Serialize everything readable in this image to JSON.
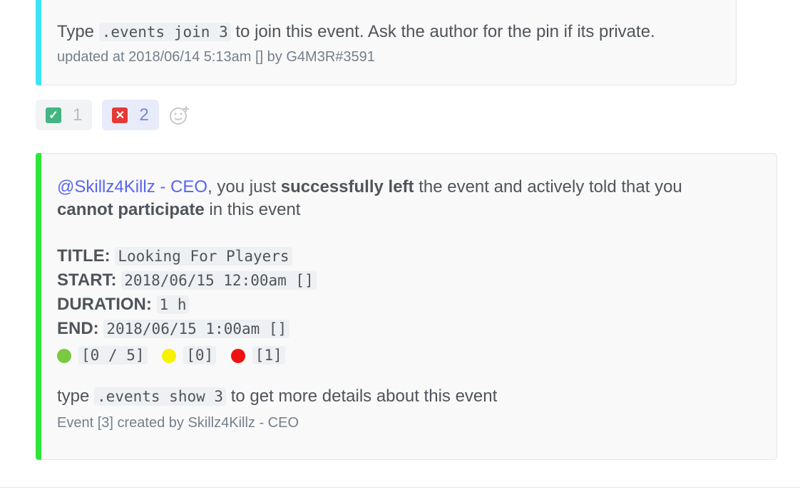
{
  "top_embed": {
    "accent": "#3ee3f5",
    "text_before": "Type ",
    "code": ".events join 3",
    "text_after": " to join this event. Ask the author for the pin if its private.",
    "footer": "updated at 2018/06/14 5:13am [] by G4M3R#3591"
  },
  "reactions": [
    {
      "emoji": "check-box",
      "color": "#43b581",
      "count": "1",
      "active": false
    },
    {
      "emoji": "cross-box",
      "color": "#e53935",
      "count": "2",
      "active": true
    }
  ],
  "bottom_embed": {
    "accent": "#2ee63a",
    "mention": "@Skillz4Killz - CEO",
    "text1": ", you just ",
    "bold1": "successfully left",
    "text2": " the event and actively told that you",
    "bold2": "cannot participate",
    "text3": " in this event",
    "fields": [
      {
        "label": "TITLE:",
        "value": "Looking For Players"
      },
      {
        "label": "START:",
        "value": "2018/06/15 12:00am []"
      },
      {
        "label": "DURATION:",
        "value": "1 h"
      },
      {
        "label": "END:",
        "value": "2018/06/15 1:00am []"
      }
    ],
    "status": [
      {
        "color": "#7ac943",
        "value": "[0 / 5]"
      },
      {
        "color": "#f7f200",
        "value": "[0]"
      },
      {
        "color": "#ee1111",
        "value": "[1]"
      }
    ],
    "hint_before": "type ",
    "hint_code": ".events show 3",
    "hint_after": " to get more details about this event",
    "footer": "Event [3] created by Skillz4Killz - CEO"
  }
}
